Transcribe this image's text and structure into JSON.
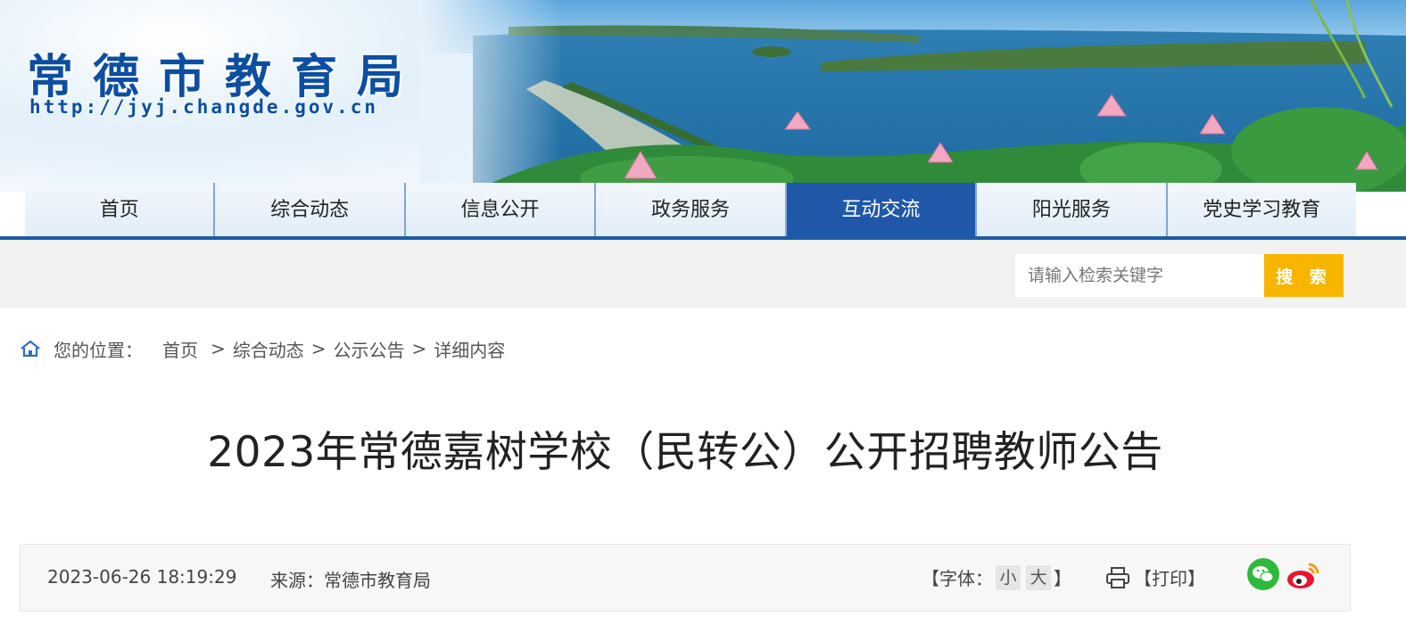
{
  "header": {
    "site_title": "常德市教育局",
    "site_url": "http://jyj.changde.gov.cn"
  },
  "nav": {
    "items": [
      {
        "label": "首页"
      },
      {
        "label": "综合动态"
      },
      {
        "label": "信息公开"
      },
      {
        "label": "政务服务"
      },
      {
        "label": "互动交流"
      },
      {
        "label": "阳光服务"
      },
      {
        "label": "党史学习教育"
      }
    ],
    "active_index": 4
  },
  "search": {
    "placeholder": "请输入检索关键字",
    "button_label": "搜 索"
  },
  "breadcrumb": {
    "label": "您的位置：",
    "items": [
      "首页",
      "综合动态",
      "公示公告",
      "详细内容"
    ],
    "separator": ">"
  },
  "article": {
    "title": "2023年常德嘉树学校（民转公）公开招聘教师公告",
    "date": "2023-06-26 18:19:29",
    "source": "来源：常德市教育局"
  },
  "tools": {
    "font_label": "【字体：",
    "font_small": "小",
    "font_large": "大",
    "font_close": "】",
    "print_label": "【打印】"
  },
  "colors": {
    "brand_blue": "#1f58a8",
    "search_button": "#f7b500",
    "wechat_green": "#2dba3a",
    "weibo_red": "#e6162d"
  },
  "icons": {
    "home": "home-icon",
    "print": "printer-icon",
    "wechat": "wechat-icon",
    "weibo": "weibo-icon"
  }
}
